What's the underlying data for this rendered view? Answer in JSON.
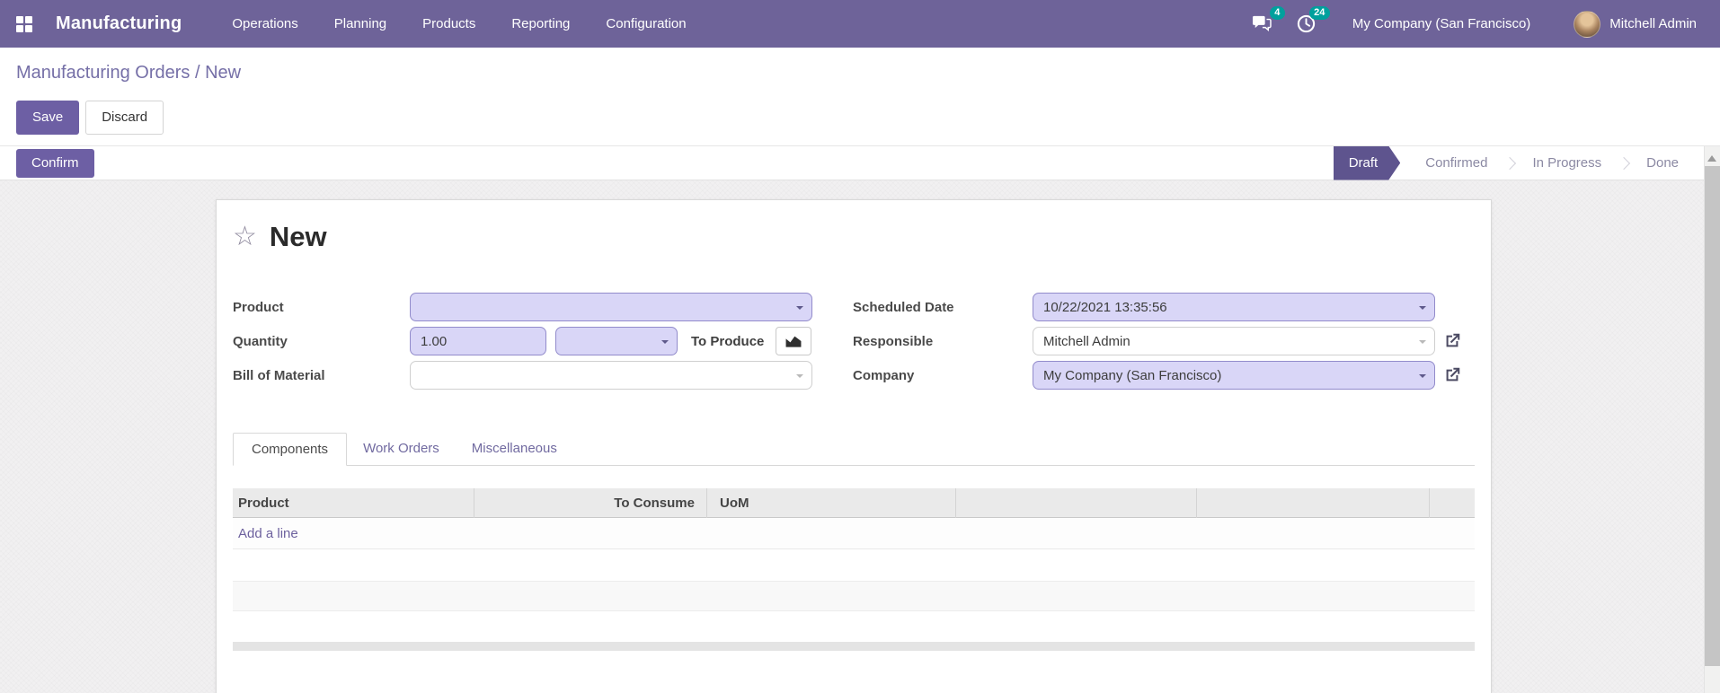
{
  "nav": {
    "app_name": "Manufacturing",
    "menus": [
      "Operations",
      "Planning",
      "Products",
      "Reporting",
      "Configuration"
    ],
    "messages_badge": "4",
    "activities_badge": "24",
    "company": "My Company (San Francisco)",
    "user": "Mitchell Admin"
  },
  "breadcrumb": {
    "parent": "Manufacturing Orders",
    "separator": " / ",
    "current": "New"
  },
  "control": {
    "save": "Save",
    "discard": "Discard",
    "confirm": "Confirm"
  },
  "statusbar": {
    "active_step": "Draft",
    "steps": [
      "Draft",
      "Confirmed",
      "In Progress",
      "Done"
    ]
  },
  "form": {
    "title": "New",
    "fields": {
      "product_label": "Product",
      "quantity_label": "Quantity",
      "quantity_value": "1.00",
      "to_produce_label": "To Produce",
      "bom_label": "Bill of Material",
      "scheduled_date_label": "Scheduled Date",
      "scheduled_date_value": "10/22/2021 13:35:56",
      "responsible_label": "Responsible",
      "responsible_value": "Mitchell Admin",
      "company_label": "Company",
      "company_value": "My Company (San Francisco)"
    },
    "tabs": [
      "Components",
      "Work Orders",
      "Miscellaneous"
    ],
    "components_table": {
      "headers": [
        "Product",
        "To Consume",
        "UoM",
        "",
        "",
        ""
      ],
      "add_line": "Add a line"
    }
  },
  "colors": {
    "navbar": "#6E6399",
    "primary_button": "#6D5FA4",
    "status_active": "#5E548E",
    "badge": "#00A09D",
    "field_highlight": "#D9D6F7",
    "link": "#756FA7"
  }
}
